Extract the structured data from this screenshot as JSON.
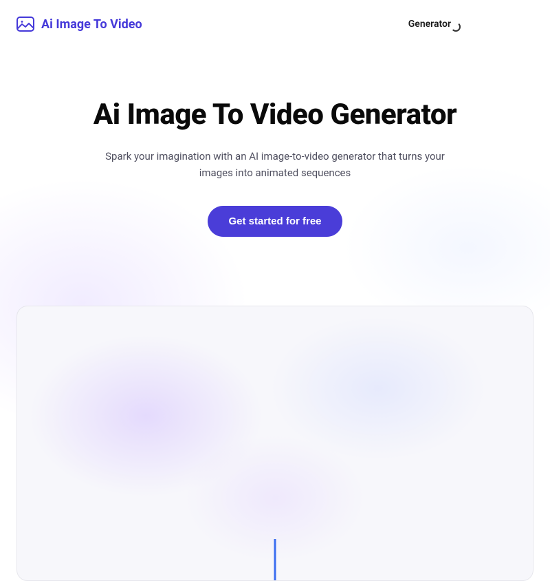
{
  "brand": {
    "name": "Ai Image To Video"
  },
  "nav": {
    "item1": "Generator"
  },
  "hero": {
    "title": "Ai Image To Video Generator",
    "subtitle": "Spark your imagination with an AI image-to-video generator that turns your images into animated sequences",
    "cta": "Get started for free"
  },
  "colors": {
    "accent": "#4a3dd8"
  }
}
